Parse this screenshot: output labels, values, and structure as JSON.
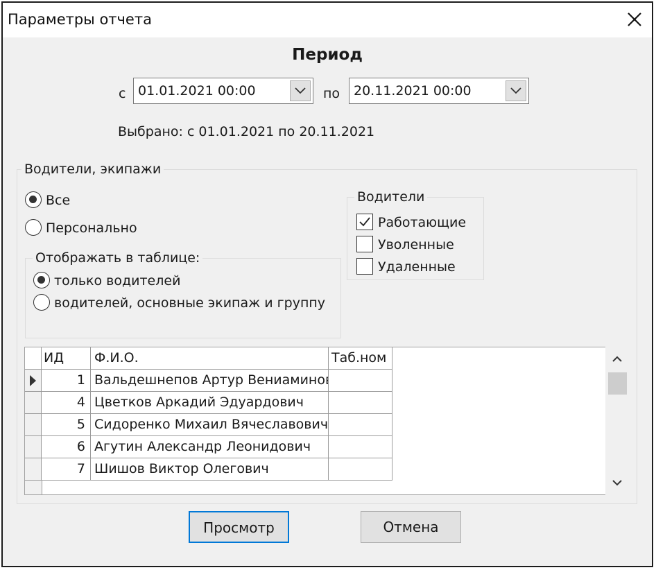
{
  "window": {
    "title": "Параметры отчета"
  },
  "period": {
    "heading": "Период",
    "from_label": "с",
    "from_value": "01.01.2021 00:00",
    "to_label": "по",
    "to_value": "20.11.2021 00:00",
    "selected_text": "Выбрано: с 01.01.2021 по 20.11.2021"
  },
  "drivers_group": {
    "legend": "Водители, экипажи",
    "radio_all": "Все",
    "radio_personal": "Персонально",
    "selected": "all",
    "display": {
      "legend": "Отображать в таблице:",
      "radio_drivers_only": "только водителей",
      "radio_drivers_crew": "водителей, основные экипаж и группу",
      "selected": "drivers_only"
    },
    "filter": {
      "legend": "Водители",
      "items": [
        {
          "label": "Работающие",
          "checked": true
        },
        {
          "label": "Уволенные",
          "checked": false
        },
        {
          "label": "Удаленные",
          "checked": false
        }
      ]
    }
  },
  "table": {
    "columns": [
      "ИД",
      "Ф.И.О.",
      "Таб.ном"
    ],
    "rows": [
      {
        "id": "1",
        "name": "Вальдешнепов Артур Вениаминович",
        "tab": ""
      },
      {
        "id": "4",
        "name": "Цветков Аркадий Эдуардович",
        "tab": ""
      },
      {
        "id": "5",
        "name": "Сидоренко Михаил Вячеславович",
        "tab": ""
      },
      {
        "id": "6",
        "name": "Агутин Александр Леонидович",
        "tab": ""
      },
      {
        "id": "7",
        "name": "Шишов Виктор Олегович",
        "tab": ""
      }
    ],
    "current_row": 0
  },
  "buttons": {
    "preview": "Просмотр",
    "cancel": "Отмена"
  }
}
